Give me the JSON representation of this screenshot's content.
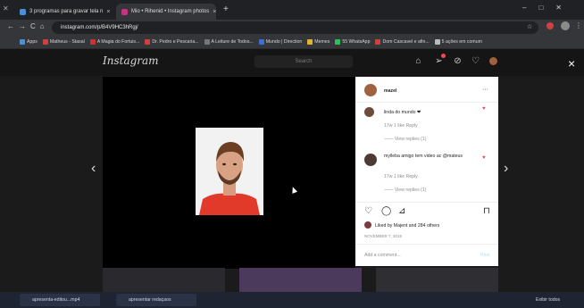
{
  "browser": {
    "tabs": [
      {
        "title": "3 programas para gravar tela n"
      },
      {
        "title": "Mio • Rihenid • Instagram photos"
      }
    ],
    "new_tab": "+",
    "url": "instagram.com/p/B4V9HC3hRgj/",
    "bookmarks": [
      {
        "label": "Apps",
        "color": "#4a90d9"
      },
      {
        "label": "Matheus - Stasal",
        "color": "#d04040"
      },
      {
        "label": "A Magia do Fortuis...",
        "color": "#c83434"
      },
      {
        "label": "Dr. Pedro e Pescaria...",
        "color": "#d04040"
      },
      {
        "label": "A Leiture de Todos...",
        "color": "#777"
      },
      {
        "label": "Mundo | Direction",
        "color": "#3b6fd4"
      },
      {
        "label": "Memes",
        "color": "#e2b233"
      },
      {
        "label": "55 WhatsApp",
        "color": "#2fbf5b"
      },
      {
        "label": "Dom Cascavel e afin...",
        "color": "#d04040"
      },
      {
        "label": "5 ações em comum",
        "color": "#bbb"
      }
    ]
  },
  "instagram": {
    "logo": "Instagram",
    "search_placeholder": "Search",
    "close": "×",
    "prev_arrow": "‹",
    "next_arrow": "›",
    "post": {
      "username": "mazel",
      "more": "···",
      "comments": [
        {
          "text": "linda do mundo ❤",
          "meta": "17w 1 like Reply",
          "view": "—— View replies (1)"
        },
        {
          "text": "mylleba amigo tem video ac @mateus",
          "meta": "17w 1 like Reply",
          "view": "—— View replies (1)"
        }
      ],
      "liked_by": "Liked by Majent and 284 others",
      "date": "NOVEMBER 7, 2019",
      "add_comment_placeholder": "Add a comment...",
      "post_btn": "Post"
    }
  },
  "taskbar": {
    "items": [
      {
        "label": "apresenta-editou...mp4"
      },
      {
        "label": "apresentar redaçaos"
      }
    ],
    "tray": "Exibir todos"
  },
  "colors": {
    "accent_red": "#ed4956",
    "ig_blue": "#0095f6"
  }
}
